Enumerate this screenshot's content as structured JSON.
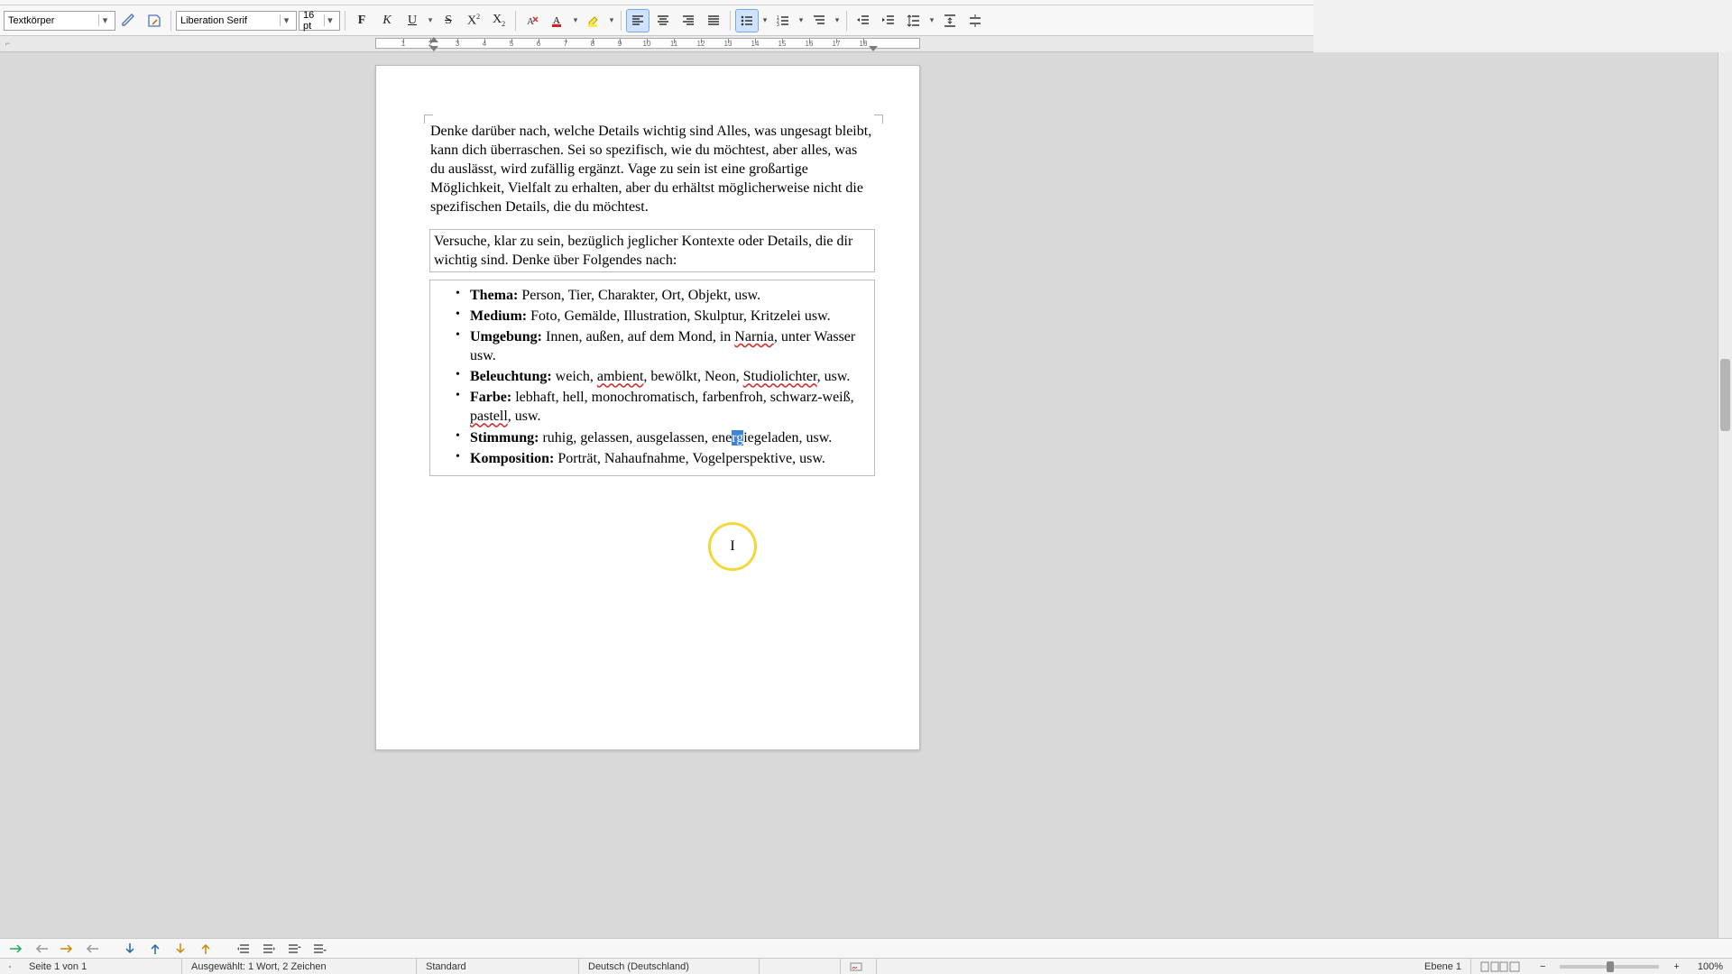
{
  "toolbar": {
    "para_style": "Textkörper",
    "font_name": "Liberation Serif",
    "font_size": "16 pt"
  },
  "ruler": {
    "numbers": [
      "1",
      "2",
      "3",
      "4",
      "5",
      "6",
      "7",
      "8",
      "9",
      "10",
      "11",
      "12",
      "13",
      "14",
      "15",
      "16",
      "17",
      "18"
    ]
  },
  "document": {
    "para1": "Denke darüber nach, welche Details wichtig sind Alles, was ungesagt bleibt, kann dich überraschen. Sei so spezifisch, wie du möchtest, aber alles, was du auslässt, wird zufällig ergänzt. Vage zu sein ist eine großartige Möglichkeit, Vielfalt zu erhalten, aber du erhältst möglicherweise nicht die spezifischen Details, die du möchtest.",
    "intro": "Versuche, klar zu sein, bezüglich jeglicher Kontexte oder Details, die dir wichtig sind. Denke über Folgendes nach:",
    "items": [
      {
        "label": "Thema:",
        "pre": " Person, Tier, Charakter, Ort, Objekt, usw."
      },
      {
        "label": "Medium:",
        "pre": " Foto, Gemälde, Illustration, Skulptur, Kritzelei usw."
      },
      {
        "label": "Umgebung:",
        "pre": " Innen, außen, auf dem Mond, in ",
        "spell1": "Narnia",
        "post1": ", unter Wasser usw."
      },
      {
        "label": "Beleuchtung:",
        "pre": " weich, ",
        "spell1": "ambient",
        "mid1": ", bewölkt, Neon, ",
        "spell2": "Studiolichter",
        "post2": ", usw."
      },
      {
        "label": "Farbe:",
        "pre": " lebhaft, hell, monochromatisch, farbenfroh, schwarz-weiß, ",
        "spell1": "pastell",
        "post1": ", usw."
      },
      {
        "label": "Stimmung:",
        "pre": " ruhig, gelassen, ausgelassen, ene",
        "sel": "rg",
        "post_sel": "iegeladen, usw."
      },
      {
        "label": "Komposition:",
        "pre": " Porträt, Nahaufnahme, Vogelperspektive, usw."
      }
    ],
    "cursor_char": "I"
  },
  "status": {
    "page": "Seite 1 von 1",
    "selection": "Ausgewählt: 1 Wort, 2 Zeichen",
    "style": "Standard",
    "language": "Deutsch (Deutschland)",
    "level": "Ebene 1",
    "zoom": "100%"
  }
}
